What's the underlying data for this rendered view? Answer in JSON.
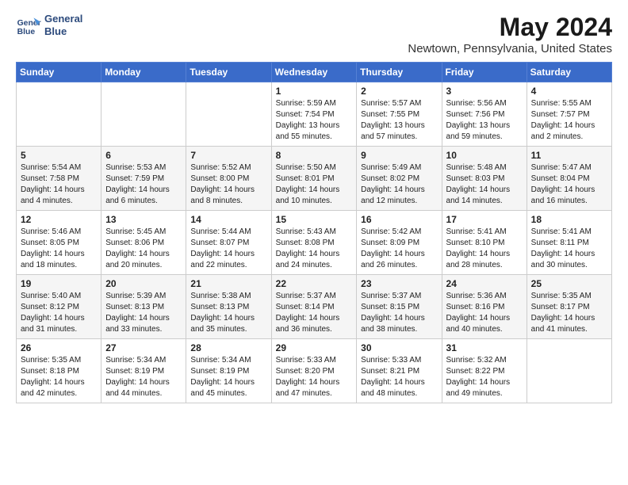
{
  "header": {
    "logo_line1": "General",
    "logo_line2": "Blue",
    "title": "May 2024",
    "subtitle": "Newtown, Pennsylvania, United States"
  },
  "weekdays": [
    "Sunday",
    "Monday",
    "Tuesday",
    "Wednesday",
    "Thursday",
    "Friday",
    "Saturday"
  ],
  "weeks": [
    [
      {
        "day": "",
        "info": ""
      },
      {
        "day": "",
        "info": ""
      },
      {
        "day": "",
        "info": ""
      },
      {
        "day": "1",
        "info": "Sunrise: 5:59 AM\nSunset: 7:54 PM\nDaylight: 13 hours\nand 55 minutes."
      },
      {
        "day": "2",
        "info": "Sunrise: 5:57 AM\nSunset: 7:55 PM\nDaylight: 13 hours\nand 57 minutes."
      },
      {
        "day": "3",
        "info": "Sunrise: 5:56 AM\nSunset: 7:56 PM\nDaylight: 13 hours\nand 59 minutes."
      },
      {
        "day": "4",
        "info": "Sunrise: 5:55 AM\nSunset: 7:57 PM\nDaylight: 14 hours\nand 2 minutes."
      }
    ],
    [
      {
        "day": "5",
        "info": "Sunrise: 5:54 AM\nSunset: 7:58 PM\nDaylight: 14 hours\nand 4 minutes."
      },
      {
        "day": "6",
        "info": "Sunrise: 5:53 AM\nSunset: 7:59 PM\nDaylight: 14 hours\nand 6 minutes."
      },
      {
        "day": "7",
        "info": "Sunrise: 5:52 AM\nSunset: 8:00 PM\nDaylight: 14 hours\nand 8 minutes."
      },
      {
        "day": "8",
        "info": "Sunrise: 5:50 AM\nSunset: 8:01 PM\nDaylight: 14 hours\nand 10 minutes."
      },
      {
        "day": "9",
        "info": "Sunrise: 5:49 AM\nSunset: 8:02 PM\nDaylight: 14 hours\nand 12 minutes."
      },
      {
        "day": "10",
        "info": "Sunrise: 5:48 AM\nSunset: 8:03 PM\nDaylight: 14 hours\nand 14 minutes."
      },
      {
        "day": "11",
        "info": "Sunrise: 5:47 AM\nSunset: 8:04 PM\nDaylight: 14 hours\nand 16 minutes."
      }
    ],
    [
      {
        "day": "12",
        "info": "Sunrise: 5:46 AM\nSunset: 8:05 PM\nDaylight: 14 hours\nand 18 minutes."
      },
      {
        "day": "13",
        "info": "Sunrise: 5:45 AM\nSunset: 8:06 PM\nDaylight: 14 hours\nand 20 minutes."
      },
      {
        "day": "14",
        "info": "Sunrise: 5:44 AM\nSunset: 8:07 PM\nDaylight: 14 hours\nand 22 minutes."
      },
      {
        "day": "15",
        "info": "Sunrise: 5:43 AM\nSunset: 8:08 PM\nDaylight: 14 hours\nand 24 minutes."
      },
      {
        "day": "16",
        "info": "Sunrise: 5:42 AM\nSunset: 8:09 PM\nDaylight: 14 hours\nand 26 minutes."
      },
      {
        "day": "17",
        "info": "Sunrise: 5:41 AM\nSunset: 8:10 PM\nDaylight: 14 hours\nand 28 minutes."
      },
      {
        "day": "18",
        "info": "Sunrise: 5:41 AM\nSunset: 8:11 PM\nDaylight: 14 hours\nand 30 minutes."
      }
    ],
    [
      {
        "day": "19",
        "info": "Sunrise: 5:40 AM\nSunset: 8:12 PM\nDaylight: 14 hours\nand 31 minutes."
      },
      {
        "day": "20",
        "info": "Sunrise: 5:39 AM\nSunset: 8:13 PM\nDaylight: 14 hours\nand 33 minutes."
      },
      {
        "day": "21",
        "info": "Sunrise: 5:38 AM\nSunset: 8:13 PM\nDaylight: 14 hours\nand 35 minutes."
      },
      {
        "day": "22",
        "info": "Sunrise: 5:37 AM\nSunset: 8:14 PM\nDaylight: 14 hours\nand 36 minutes."
      },
      {
        "day": "23",
        "info": "Sunrise: 5:37 AM\nSunset: 8:15 PM\nDaylight: 14 hours\nand 38 minutes."
      },
      {
        "day": "24",
        "info": "Sunrise: 5:36 AM\nSunset: 8:16 PM\nDaylight: 14 hours\nand 40 minutes."
      },
      {
        "day": "25",
        "info": "Sunrise: 5:35 AM\nSunset: 8:17 PM\nDaylight: 14 hours\nand 41 minutes."
      }
    ],
    [
      {
        "day": "26",
        "info": "Sunrise: 5:35 AM\nSunset: 8:18 PM\nDaylight: 14 hours\nand 42 minutes."
      },
      {
        "day": "27",
        "info": "Sunrise: 5:34 AM\nSunset: 8:19 PM\nDaylight: 14 hours\nand 44 minutes."
      },
      {
        "day": "28",
        "info": "Sunrise: 5:34 AM\nSunset: 8:19 PM\nDaylight: 14 hours\nand 45 minutes."
      },
      {
        "day": "29",
        "info": "Sunrise: 5:33 AM\nSunset: 8:20 PM\nDaylight: 14 hours\nand 47 minutes."
      },
      {
        "day": "30",
        "info": "Sunrise: 5:33 AM\nSunset: 8:21 PM\nDaylight: 14 hours\nand 48 minutes."
      },
      {
        "day": "31",
        "info": "Sunrise: 5:32 AM\nSunset: 8:22 PM\nDaylight: 14 hours\nand 49 minutes."
      },
      {
        "day": "",
        "info": ""
      }
    ]
  ]
}
